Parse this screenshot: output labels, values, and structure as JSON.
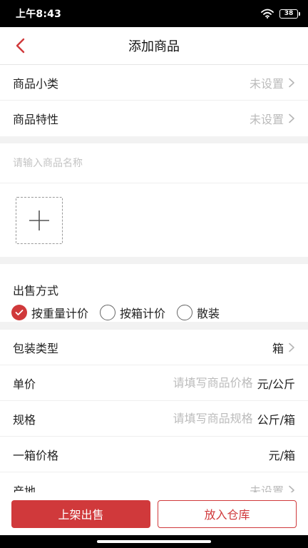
{
  "status_bar": {
    "time": "上午8:43",
    "battery": "38",
    "wifi_icon": "wifi-icon",
    "battery_icon": "battery-icon"
  },
  "nav": {
    "title": "添加商品",
    "back_icon": "chevron-left-icon"
  },
  "category": {
    "rows": [
      {
        "label": "商品小类",
        "value": "未设置"
      },
      {
        "label": "商品特性",
        "value": "未设置"
      }
    ]
  },
  "product": {
    "name_placeholder": "请输入商品名称",
    "add_photo_icon": "plus-icon"
  },
  "sale_method": {
    "title": "出售方式",
    "options": [
      {
        "label": "按重量计价",
        "checked": true
      },
      {
        "label": "按箱计价",
        "checked": false
      },
      {
        "label": "散装",
        "checked": false
      }
    ]
  },
  "details": {
    "packaging": {
      "label": "包装类型",
      "value": "箱"
    },
    "unit_price": {
      "label": "单价",
      "placeholder": "请填写商品价格",
      "unit": "元/公斤"
    },
    "spec": {
      "label": "规格",
      "placeholder": "请填写商品规格",
      "unit": "公斤/箱"
    },
    "box_price": {
      "label": "一箱价格",
      "unit": "元/箱"
    },
    "origin": {
      "label": "产地",
      "value": "未设置"
    }
  },
  "actions": {
    "primary": "上架出售",
    "secondary": "放入仓库"
  },
  "colors": {
    "accent": "#d0393b",
    "background": "#f2f2f2",
    "placeholder": "#bbbbbb"
  }
}
